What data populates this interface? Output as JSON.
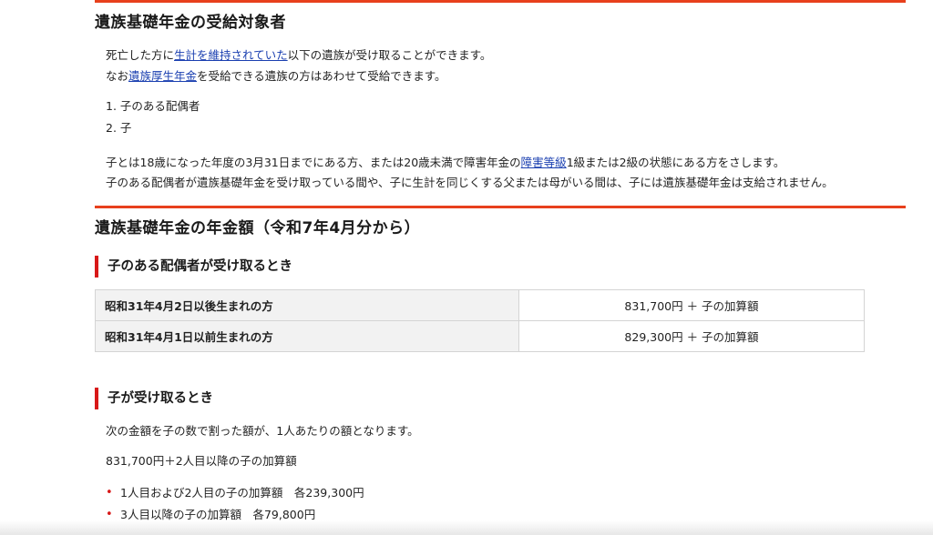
{
  "section1": {
    "title": "遺族基礎年金の受給対象者",
    "line1_pre": "死亡した方に",
    "line1_link": "生計を維持されていた",
    "line1_post": "以下の遺族が受け取ることができます。",
    "line2_pre": "なお",
    "line2_link": "遺族厚生年金",
    "line2_post": "を受給できる遺族の方はあわせて受給できます。",
    "items": [
      "1. 子のある配偶者",
      "2. 子"
    ],
    "note1_pre": "子とは18歳になった年度の3月31日までにある方、または20歳未満で障害年金の",
    "note1_link": "障害等級",
    "note1_post": "1級または2級の状態にある方をさします。",
    "note2": "子のある配偶者が遺族基礎年金を受け取っている間や、子に生計を同じくする父または母がいる間は、子には遺族基礎年金は支給されません。"
  },
  "section2": {
    "title": "遺族基礎年金の年金額（令和7年4月分から）",
    "spouse": {
      "title": "子のある配偶者が受け取るとき",
      "rows": [
        {
          "label": "昭和31年4月2日以後生まれの方",
          "value": "831,700円 ＋ 子の加算額"
        },
        {
          "label": "昭和31年4月1日以前生まれの方",
          "value": "829,300円 ＋ 子の加算額"
        }
      ]
    },
    "child": {
      "title": "子が受け取るとき",
      "desc": "次の金額を子の数で割った額が、1人あたりの額となります。",
      "formula": "831,700円＋2人目以降の子の加算額",
      "bullets": [
        "1人目および2人目の子の加算額　各239,300円",
        "3人目以降の子の加算額　各79,800円"
      ]
    }
  },
  "colors": {
    "accent_rule": "#e8401c",
    "subheading_bar": "#d81818",
    "link": "#1a3fb0"
  }
}
